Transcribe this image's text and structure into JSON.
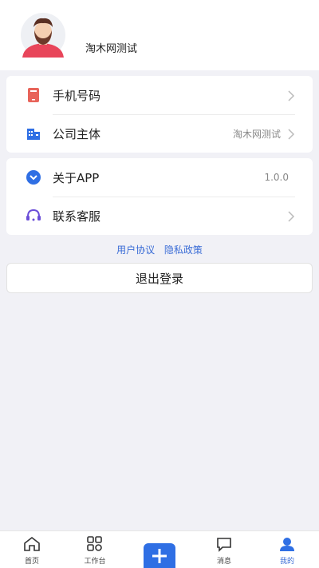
{
  "user": {
    "name": "淘木网测试"
  },
  "menu_group_1": [
    {
      "label": "手机号码",
      "value": "",
      "icon": "phone-icon"
    },
    {
      "label": "公司主体",
      "value": "淘木网测试",
      "icon": "company-icon"
    }
  ],
  "menu_group_2": [
    {
      "label": "关于APP",
      "value": "1.0.0",
      "icon": "about-icon"
    },
    {
      "label": "联系客服",
      "value": "",
      "icon": "headset-icon"
    }
  ],
  "links": {
    "agreement": "用户协议",
    "privacy": "隐私政策"
  },
  "logout_label": "退出登录",
  "tabbar": {
    "home": "首页",
    "work": "工作台",
    "msg": "消息",
    "mine": "我的"
  },
  "colors": {
    "accent": "#3a6cd6",
    "fab": "#2f6fe4",
    "phone_icon": "#e8645a"
  }
}
